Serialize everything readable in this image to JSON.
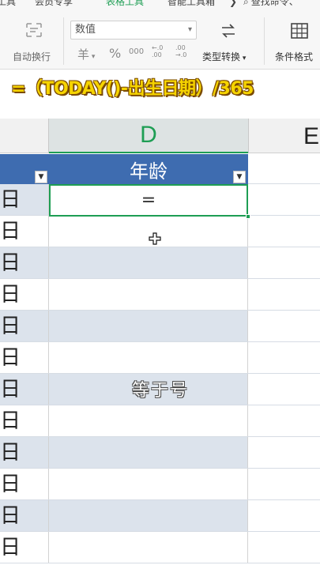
{
  "menu": {
    "items": [
      "工具",
      "会员专享",
      "表格工具",
      "智能工具箱"
    ],
    "active_index": 2,
    "search_label": "查找命令、",
    "arrow_label": "❯"
  },
  "ribbon": {
    "wrap_text_label": "自动换行",
    "number_format_value": "数值",
    "currency_symbol": "羊",
    "percent_symbol": "%",
    "thousands_symbol": "000",
    "increase_decimal_symbol": "←.0 .00",
    "decrease_decimal_symbol": ".00 →.0",
    "type_convert_label": "类型转换",
    "conditional_format_label": "条件格式"
  },
  "caption": {
    "formula": "=（TODAY()-出生日期）/365"
  },
  "sheet": {
    "column_d_label": "D",
    "column_e_label": "E",
    "header_title": "年龄",
    "active_cell_value": "=",
    "row_left_label": "日",
    "rows": [
      {
        "left": "日",
        "band": true
      },
      {
        "left": "日",
        "band": false
      },
      {
        "left": "日",
        "band": true
      },
      {
        "left": "日",
        "band": false
      },
      {
        "left": "日",
        "band": true
      },
      {
        "left": "日",
        "band": false
      },
      {
        "left": "日",
        "band": true
      },
      {
        "left": "日",
        "band": false
      },
      {
        "left": "日",
        "band": true
      },
      {
        "left": "日",
        "band": false
      },
      {
        "left": "日",
        "band": true
      },
      {
        "left": "日",
        "band": false
      }
    ]
  },
  "subtitle": "等于号",
  "colors": {
    "accent_green": "#1e9e54",
    "header_blue": "#3e6cb0",
    "band_blue": "#dce3ec",
    "caption_yellow": "#f6d400"
  }
}
